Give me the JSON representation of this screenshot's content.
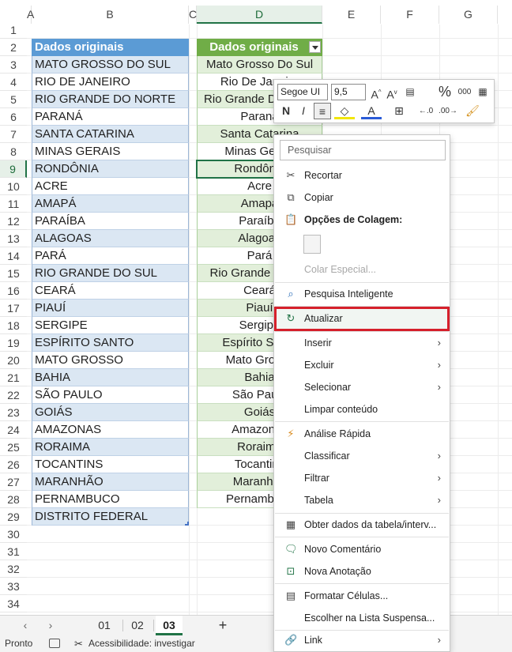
{
  "columns": [
    "A",
    "B",
    "C",
    "D",
    "E",
    "F",
    "G"
  ],
  "rows": [
    1,
    2,
    3,
    4,
    5,
    6,
    7,
    8,
    9,
    10,
    11,
    12,
    13,
    14,
    15,
    16,
    17,
    18,
    19,
    20,
    21,
    22,
    23,
    24,
    25,
    26,
    27,
    28,
    29,
    30,
    31,
    32,
    33,
    34
  ],
  "tableB": {
    "header": "Dados originais",
    "values": [
      "MATO GROSSO DO SUL",
      "RIO DE JANEIRO",
      "RIO GRANDE DO NORTE",
      "PARANÁ",
      "SANTA CATARINA",
      "MINAS GERAIS",
      "RONDÔNIA",
      "ACRE",
      "AMAPÁ",
      "PARAÍBA",
      "ALAGOAS",
      "PARÁ",
      "RIO GRANDE DO SUL",
      "CEARÁ",
      "PIAUÍ",
      "SERGIPE",
      "ESPÍRITO SANTO",
      "MATO GROSSO",
      "BAHIA",
      "SÃO PAULO",
      "GOIÁS",
      "AMAZONAS",
      "RORAIMA",
      "TOCANTINS",
      "MARANHÃO",
      "PERNAMBUCO",
      "DISTRITO FEDERAL"
    ]
  },
  "tableD": {
    "header": "Dados originais",
    "values": [
      "Mato Grosso Do Sul",
      "Rio De Janeiro",
      "Rio Grande Do Norte",
      "Paraná",
      "Santa Catarina",
      "Minas Gerais",
      "Rondônia",
      "Acre",
      "Amapá",
      "Paraíba",
      "Alagoas",
      "Pará",
      "Rio Grande Do Sul",
      "Ceará",
      "Piauí",
      "Sergipe",
      "Espírito Santo",
      "Mato Grosso",
      "Bahia",
      "São Paulo",
      "Goiás",
      "Amazonas",
      "Roraima",
      "Tocantins",
      "Maranhão",
      "Pernambuco"
    ]
  },
  "sheets": {
    "tabs": [
      "01",
      "02",
      "03"
    ],
    "active": "03",
    "add_label": "+"
  },
  "status": {
    "ready": "Pronto",
    "accessibility": "Acessibilidade: investigar"
  },
  "minitoolbar": {
    "font": "Segoe UI",
    "size": "9,5",
    "bold": "N",
    "italic": "I",
    "percent": "%",
    "thousands": "000"
  },
  "menu": {
    "search_placeholder": "Pesquisar",
    "items": {
      "recortar": "Recortar",
      "copiar": "Copiar",
      "opcoes_colagem": "Opções de Colagem:",
      "colar_especial": "Colar Especial...",
      "pesquisa_inteligente": "Pesquisa Inteligente",
      "atualizar": "Atualizar",
      "inserir": "Inserir",
      "excluir": "Excluir",
      "selecionar": "Selecionar",
      "limpar": "Limpar conteúdo",
      "analise": "Análise Rápida",
      "classificar": "Classificar",
      "filtrar": "Filtrar",
      "tabela": "Tabela",
      "obter_dados": "Obter dados da tabela/interv...",
      "novo_comentario": "Novo Comentário",
      "nova_anotacao": "Nova Anotação",
      "formatar": "Formatar Células...",
      "escolher": "Escolher na Lista Suspensa...",
      "link": "Link"
    }
  },
  "colors": {
    "accent_green": "#217346",
    "blue_header": "#5b9bd5",
    "green_header": "#70ad47",
    "highlight_red": "#d6202b"
  }
}
